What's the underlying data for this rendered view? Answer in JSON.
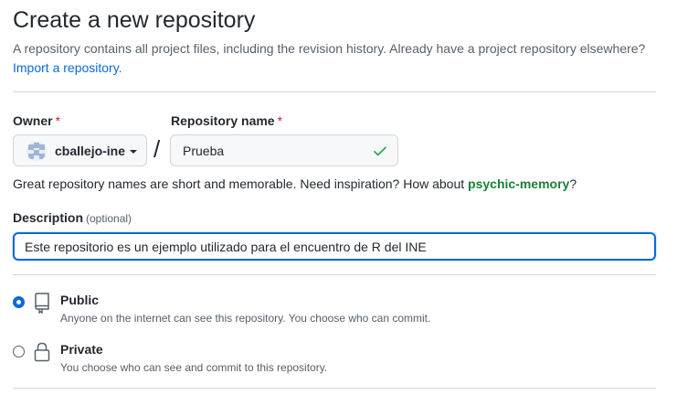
{
  "header": {
    "title": "Create a new repository",
    "subtitle": "A repository contains all project files, including the revision history. Already have a project repository elsewhere?",
    "import_link": "Import a repository."
  },
  "owner": {
    "label": "Owner",
    "required_mark": "*",
    "selected": "cballejo-ine"
  },
  "separator": "/",
  "repository_name": {
    "label": "Repository name",
    "required_mark": "*",
    "value": "Prueba",
    "valid_icon": "check-icon"
  },
  "name_hint": {
    "text": "Great repository names are short and memorable. Need inspiration? How about",
    "suggestion": "psychic-memory",
    "suffix": "?"
  },
  "description": {
    "label": "Description",
    "optional": "(optional)",
    "value": "Este repositorio es un ejemplo utilizado para el encuentro de R del INE"
  },
  "visibility": {
    "options": [
      {
        "title": "Public",
        "description": "Anyone on the internet can see this repository. You choose who can commit.",
        "icon": "repo-icon",
        "selected": true
      },
      {
        "title": "Private",
        "description": "You choose who can see and commit to this repository.",
        "icon": "lock-icon",
        "selected": false
      }
    ]
  },
  "colors": {
    "accent": "#0969da",
    "success": "#1a7f37",
    "required": "#cf222e",
    "muted": "#57606a"
  }
}
